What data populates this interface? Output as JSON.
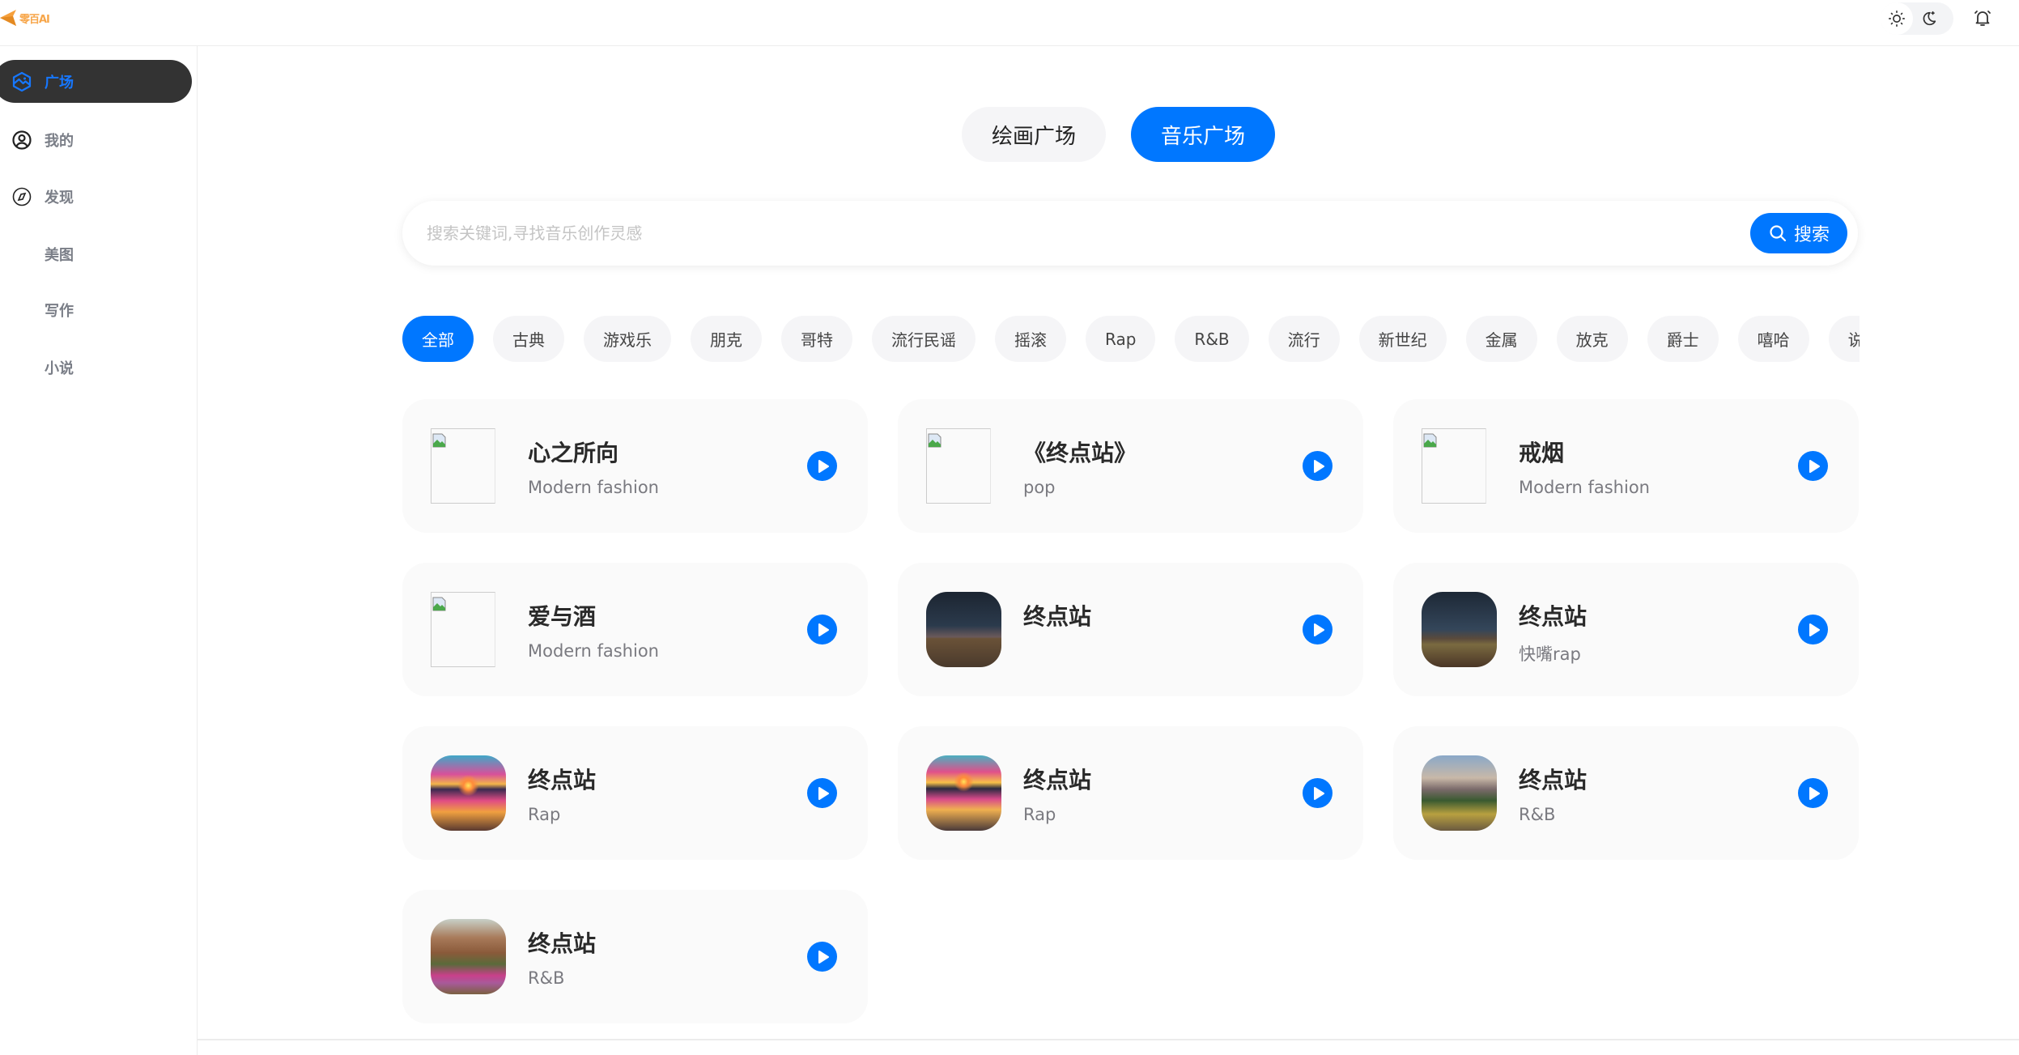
{
  "app": {
    "logo_text": "零百AI"
  },
  "header": {
    "theme_light_icon": "sun-icon",
    "theme_dark_icon": "moon-icon",
    "notification_icon": "bell-icon"
  },
  "sidebar": {
    "items": [
      {
        "label": "广场",
        "icon": "hexagon-image-icon",
        "active": true
      },
      {
        "label": "我的",
        "icon": "user-circle-icon",
        "active": false
      },
      {
        "label": "发现",
        "icon": "compass-icon",
        "active": false
      },
      {
        "label": "美图",
        "icon": "",
        "active": false
      },
      {
        "label": "写作",
        "icon": "",
        "active": false
      },
      {
        "label": "小说",
        "icon": "",
        "active": false
      }
    ]
  },
  "tabs": [
    {
      "label": "绘画广场",
      "active": false
    },
    {
      "label": "音乐广场",
      "active": true
    }
  ],
  "search": {
    "placeholder": "搜索关键词,寻找音乐创作灵感",
    "value": "",
    "button_label": "搜索"
  },
  "categories": [
    {
      "label": "全部",
      "active": true
    },
    {
      "label": "古典"
    },
    {
      "label": "游戏乐"
    },
    {
      "label": "朋克"
    },
    {
      "label": "哥特"
    },
    {
      "label": "流行民谣"
    },
    {
      "label": "摇滚"
    },
    {
      "label": "Rap"
    },
    {
      "label": "R&B"
    },
    {
      "label": "流行"
    },
    {
      "label": "新世纪"
    },
    {
      "label": "金属"
    },
    {
      "label": "放克"
    },
    {
      "label": "爵士"
    },
    {
      "label": "嘻哈"
    },
    {
      "label": "说唱"
    }
  ],
  "songs": [
    {
      "title": "心之所向",
      "style": "Modern fashion",
      "cover": "broken"
    },
    {
      "title": "《终点站》",
      "style": "pop",
      "cover": "broken"
    },
    {
      "title": "戒烟",
      "style": "Modern fashion",
      "cover": "broken"
    },
    {
      "title": "爱与酒",
      "style": "Modern fashion",
      "cover": "broken"
    },
    {
      "title": "终点站",
      "style": "",
      "cover": "night-rail"
    },
    {
      "title": "终点站",
      "style": "快嘴rap",
      "cover": "night-rail-2"
    },
    {
      "title": "终点站",
      "style": "Rap",
      "cover": "sunset-rail"
    },
    {
      "title": "终点站",
      "style": "Rap",
      "cover": "sunset-rail-2"
    },
    {
      "title": "终点站",
      "style": "R&B",
      "cover": "forest-river"
    },
    {
      "title": "终点站",
      "style": "R&B",
      "cover": "mountain-path"
    }
  ],
  "colors": {
    "accent": "#0077ff",
    "sidebar_active_bg": "#333333"
  }
}
